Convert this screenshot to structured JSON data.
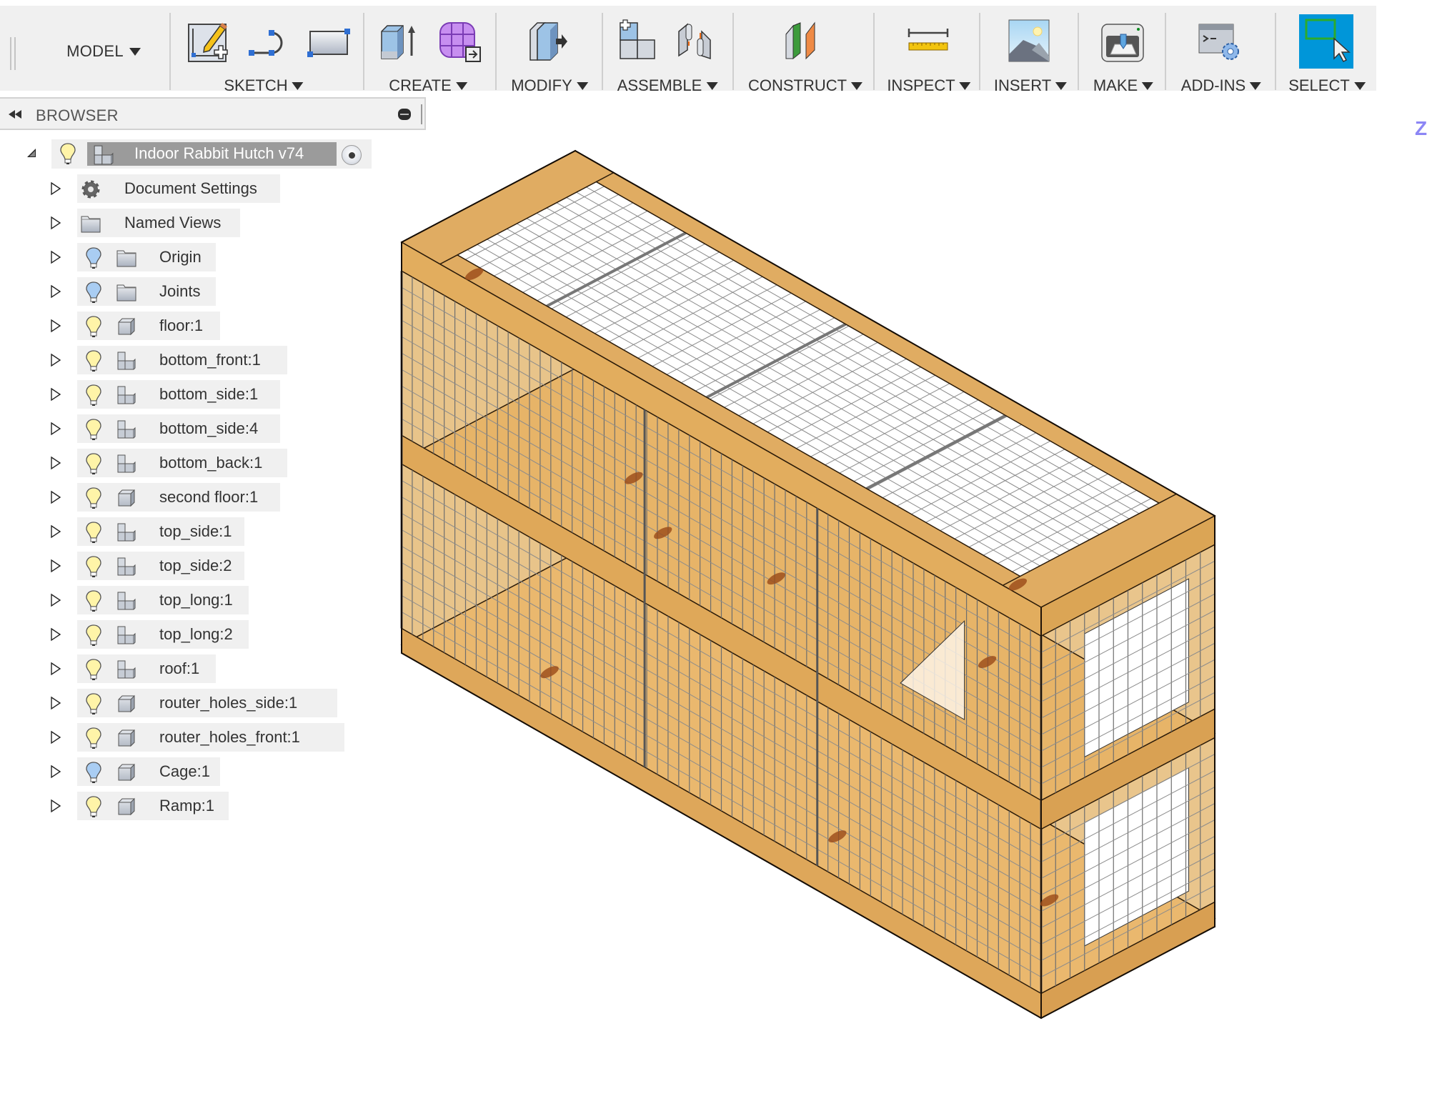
{
  "toolbar": {
    "workspace": "MODEL",
    "groups": [
      {
        "label": "SKETCH",
        "icons": [
          "create-sketch-icon",
          "arc-line-icon",
          "rectangle-icon"
        ]
      },
      {
        "label": "CREATE",
        "icons": [
          "extrude-icon",
          "form-icon"
        ]
      },
      {
        "label": "MODIFY",
        "icons": [
          "press-pull-icon"
        ]
      },
      {
        "label": "ASSEMBLE",
        "icons": [
          "new-component-icon",
          "joint-icon"
        ]
      },
      {
        "label": "CONSTRUCT",
        "icons": [
          "offset-plane-icon"
        ]
      },
      {
        "label": "INSPECT",
        "icons": [
          "measure-icon"
        ]
      },
      {
        "label": "INSERT",
        "icons": [
          "insert-image-icon"
        ]
      },
      {
        "label": "MAKE",
        "icons": [
          "3d-print-icon"
        ]
      },
      {
        "label": "ADD-INS",
        "icons": [
          "scripts-addins-icon"
        ]
      },
      {
        "label": "SELECT",
        "icons": [
          "select-icon"
        ],
        "active": true
      }
    ]
  },
  "browser": {
    "title": "BROWSER",
    "root": {
      "label": "Indoor Rabbit Hutch v74",
      "expanded": true,
      "visible": true,
      "active": true
    },
    "items": [
      {
        "label": "Document Settings",
        "icon": "gear",
        "bulb": null
      },
      {
        "label": "Named Views",
        "icon": "folder",
        "bulb": null
      },
      {
        "label": "Origin",
        "icon": "folder",
        "bulb": "blue"
      },
      {
        "label": "Joints",
        "icon": "folder",
        "bulb": "blue"
      },
      {
        "label": "floor:1",
        "icon": "body",
        "bulb": "yellow"
      },
      {
        "label": "bottom_front:1",
        "icon": "component",
        "bulb": "yellow"
      },
      {
        "label": "bottom_side:1",
        "icon": "component",
        "bulb": "yellow"
      },
      {
        "label": "bottom_side:4",
        "icon": "component",
        "bulb": "yellow"
      },
      {
        "label": "bottom_back:1",
        "icon": "component",
        "bulb": "yellow"
      },
      {
        "label": "second floor:1",
        "icon": "body",
        "bulb": "yellow"
      },
      {
        "label": "top_side:1",
        "icon": "component",
        "bulb": "yellow"
      },
      {
        "label": "top_side:2",
        "icon": "component",
        "bulb": "yellow"
      },
      {
        "label": "top_long:1",
        "icon": "component",
        "bulb": "yellow"
      },
      {
        "label": "top_long:2",
        "icon": "component",
        "bulb": "yellow"
      },
      {
        "label": "roof:1",
        "icon": "component",
        "bulb": "yellow"
      },
      {
        "label": "router_holes_side:1",
        "icon": "body",
        "bulb": "yellow"
      },
      {
        "label": "router_holes_front:1",
        "icon": "body",
        "bulb": "yellow"
      },
      {
        "label": "Cage:1",
        "icon": "body",
        "bulb": "blue"
      },
      {
        "label": "Ramp:1",
        "icon": "body",
        "bulb": "yellow"
      }
    ]
  },
  "viewport": {
    "model": "Indoor Rabbit Hutch (two-tier wooden frame with wire mesh)",
    "viewcube_fragment": "Z"
  },
  "colors": {
    "toolbar_bg": "#f0f0f0",
    "select_active": "#0096d9",
    "wood": "#e0ac62",
    "wood_dark": "#c98c3f",
    "mesh": "#6e6e6e",
    "root_highlight": "#9b9b9b"
  }
}
